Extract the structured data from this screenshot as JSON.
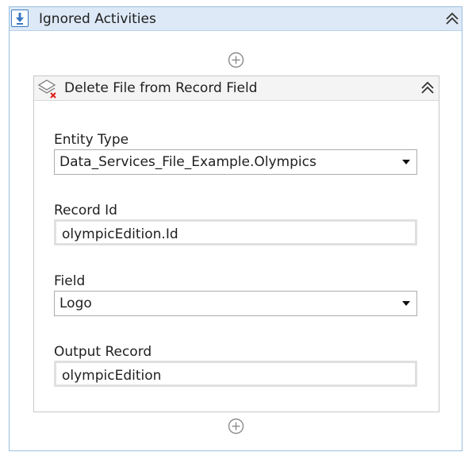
{
  "sequence": {
    "title": "Ignored Activities",
    "icon": "sequence-icon",
    "collapse_icon": "double-chevron-up-icon",
    "add_icon": "add-activity-icon"
  },
  "activity": {
    "title": "Delete File from Record Field",
    "icon": "delete-record-field-icon",
    "collapse_icon": "double-chevron-up-icon",
    "fields": {
      "entity_type": {
        "label": "Entity Type",
        "value": "Data_Services_File_Example.Olympics"
      },
      "record_id": {
        "label": "Record Id",
        "value": "olympicEdition.Id"
      },
      "field": {
        "label": "Field",
        "value": "Logo"
      },
      "output_record": {
        "label": "Output Record",
        "value": "olympicEdition"
      }
    }
  },
  "colors": {
    "accent": "#3b78c2",
    "header_bg": "#dde9f6",
    "border": "#9cc0e2",
    "delete_badge": "#e0201b"
  }
}
